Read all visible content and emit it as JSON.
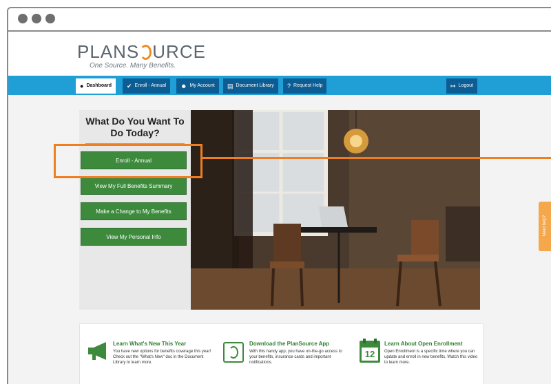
{
  "logo": {
    "text_left": "PLANS",
    "text_right": "URCE",
    "tagline": "One Source. Many Benefits."
  },
  "nav": {
    "tabs": [
      {
        "label": "Dashboard",
        "icon": "info-icon"
      },
      {
        "label": "Enroll - Annual",
        "icon": "checkmark-icon"
      },
      {
        "label": "My Account",
        "icon": "user-icon"
      },
      {
        "label": "Document Library",
        "icon": "book-icon"
      },
      {
        "label": "Request Help",
        "icon": "help-icon"
      }
    ],
    "logout": {
      "label": "Logout",
      "icon": "logout-icon"
    }
  },
  "actions": {
    "heading": "What Do You Want To Do Today?",
    "buttons": [
      "Enroll - Annual",
      "View My Full Benefits Summary",
      "Make a Change to My Benefits",
      "View My Personal Info"
    ]
  },
  "features": [
    {
      "icon": "megaphone-icon",
      "title": "Learn What's New This Year",
      "text": "You have new options for benefits coverage this year! Check out the \"What's New\" doc in the Document Library to learn more."
    },
    {
      "icon": "app-icon",
      "title": "Download the PlanSource App",
      "text": "With this handy app, you have on-the-go access to your benefits, insurance cards and important notifications."
    },
    {
      "icon": "calendar-icon",
      "calendar_day": "12",
      "title": "Learn About Open Enrollment",
      "text": "Open Enrollment is a specific time where you can update and enroll in new benefits. Watch this video to learn more."
    }
  ],
  "side_tab": {
    "label": "Need help?"
  },
  "colors": {
    "nav_blue": "#1f9fd6",
    "tab_dark": "#0c5d93",
    "button_green": "#3d8a3d",
    "accent_orange": "#ef7d22"
  }
}
